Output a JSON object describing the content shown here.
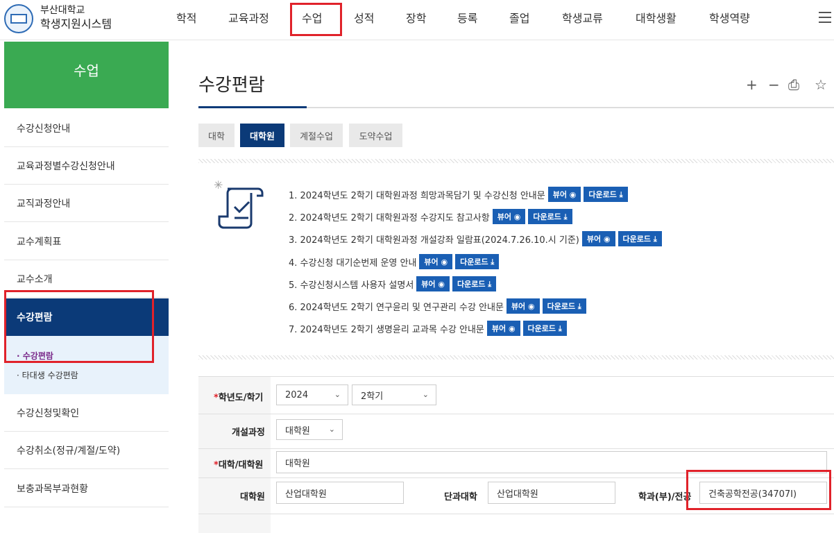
{
  "header": {
    "brand_line1": "부산대학교",
    "brand_line2": "학생지원시스템",
    "menu": [
      "학적",
      "교육과정",
      "수업",
      "성적",
      "장학",
      "등록",
      "졸업",
      "학생교류",
      "대학생활",
      "학생역량"
    ]
  },
  "sidebar": {
    "title": "수업",
    "items_top": [
      "수강신청안내",
      "교육과정별수강신청안내",
      "교직과정안내",
      "교수계획표",
      "교수소개"
    ],
    "active": "수강편람",
    "sub": [
      "· 수강편람",
      "· 타대생 수강편람"
    ],
    "items_bottom": [
      "수강신청및확인",
      "수강취소(정규/계절/도약)",
      "보충과목부과현황"
    ]
  },
  "main": {
    "title": "수강편람",
    "tools": [
      "+",
      "−",
      "⎙",
      "☆"
    ],
    "tabs": [
      "대학",
      "대학원",
      "계절수업",
      "도약수업"
    ],
    "notices": [
      "1. 2024학년도 2학기 대학원과정 희망과목담기 및 수강신청 안내문",
      "2. 2024학년도 2학기 대학원과정 수강지도 참고사항",
      "3. 2024학년도 2학기 대학원과정 개설강좌 일람표(2024.7.26.10.시 기준)",
      "4. 수강신청 대기순번제 운영 안내",
      "5. 수강신청시스템 사용자 설명서",
      "6. 2024학년도 2학기 연구윤리 및 연구관리 수강 안내문",
      "7. 2024학년도 2학기 생명윤리 교과목 수강 안내문"
    ],
    "view_label": "뷰어 ◉",
    "download_label": "다운로드 ⤓"
  },
  "form": {
    "year_label": "학년도/학기",
    "year_value": "2024",
    "term_value": "2학기",
    "course_label": "개설과정",
    "course_value": "대학원",
    "school_label": "대학/대학원",
    "school_value": "대학원",
    "grad_label": "대학원",
    "grad_value": "산업대학원",
    "college_label": "단과대학",
    "college_value": "산업대학원",
    "dept_label": "학과(부)/전공",
    "dept_value": "건축공학전공(34707I)",
    "required_mark": "*"
  },
  "colors": {
    "navy": "#0b3a78",
    "green": "#3aaa52",
    "button_blue": "#1a5fb4",
    "highlight_red": "#e0222a"
  }
}
